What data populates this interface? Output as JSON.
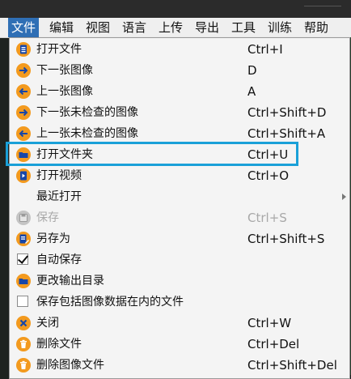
{
  "menubar": {
    "items": [
      {
        "label": "文件",
        "active": true
      },
      {
        "label": "编辑"
      },
      {
        "label": "视图"
      },
      {
        "label": "语言"
      },
      {
        "label": "上传"
      },
      {
        "label": "导出"
      },
      {
        "label": "工具"
      },
      {
        "label": "训练"
      },
      {
        "label": "帮助"
      }
    ]
  },
  "file_menu": {
    "items": [
      {
        "label": "打开文件",
        "shortcut": "Ctrl+I",
        "icon": "open-file-icon"
      },
      {
        "label": "下一张图像",
        "shortcut": "D",
        "icon": "arrow-right-icon"
      },
      {
        "label": "上一张图像",
        "shortcut": "A",
        "icon": "arrow-left-icon"
      },
      {
        "label": "下一张未检查的图像",
        "shortcut": "Ctrl+Shift+D",
        "icon": "arrow-right-icon"
      },
      {
        "label": "上一张未检查的图像",
        "shortcut": "Ctrl+Shift+A",
        "icon": "arrow-left-icon"
      },
      {
        "label": "打开文件夹",
        "shortcut": "Ctrl+U",
        "icon": "folder-icon",
        "highlighted": true
      },
      {
        "label": "打开视频",
        "shortcut": "Ctrl+O",
        "icon": "video-file-icon"
      },
      {
        "label": "最近打开",
        "shortcut": "",
        "icon": "",
        "submenu": true
      },
      {
        "label": "保存",
        "shortcut": "Ctrl+S",
        "icon": "save-icon",
        "disabled": true
      },
      {
        "label": "另存为",
        "shortcut": "Ctrl+Shift+S",
        "icon": "save-as-icon"
      },
      {
        "label": "自动保存",
        "shortcut": "",
        "checkbox": true,
        "checked": true
      },
      {
        "label": "更改输出目录",
        "shortcut": "",
        "icon": "folder-icon"
      },
      {
        "label": "保存包括图像数据在内的文件",
        "shortcut": "",
        "checkbox": true,
        "checked": false
      },
      {
        "label": "关闭",
        "shortcut": "Ctrl+W",
        "icon": "close-icon"
      },
      {
        "label": "删除文件",
        "shortcut": "Ctrl+Del",
        "icon": "delete-icon"
      },
      {
        "label": "删除图像文件",
        "shortcut": "Ctrl+Shift+Del",
        "icon": "delete-icon"
      }
    ]
  },
  "colors": {
    "menubar_active": "#2f6fb5",
    "icon_orange": "#f39a1e",
    "icon_blue": "#1746a8",
    "highlight_border": "#1aa0d8"
  }
}
